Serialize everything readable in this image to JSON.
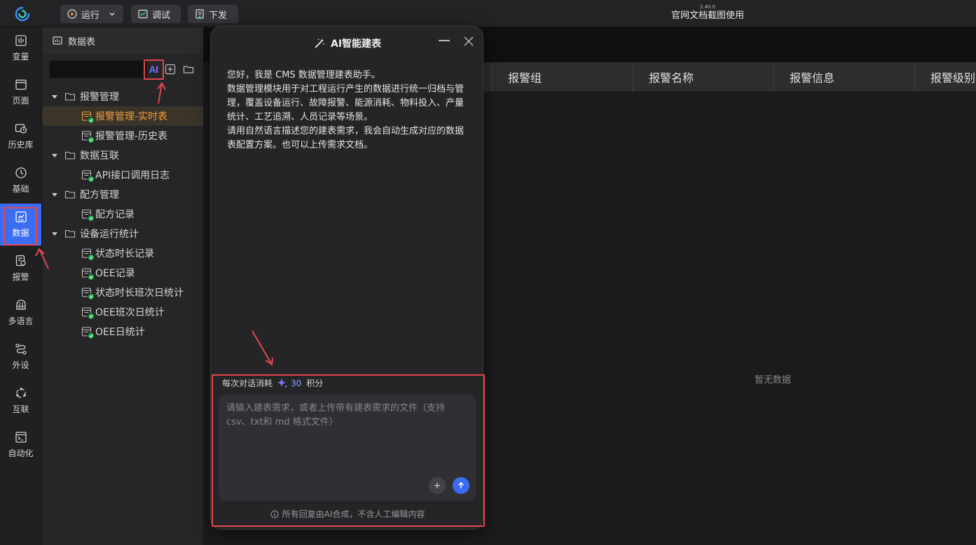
{
  "topbar": {
    "run_label": "运行",
    "debug_label": "调试",
    "deploy_label": "下发",
    "version": "2.40.0",
    "app_title": "官网文档截图使用"
  },
  "leftnav": {
    "items": [
      {
        "label": "变量",
        "icon": "variable-icon"
      },
      {
        "label": "页面",
        "icon": "page-icon"
      },
      {
        "label": "历史库",
        "icon": "history-icon"
      },
      {
        "label": "基础",
        "icon": "base-icon"
      },
      {
        "label": "数据",
        "icon": "data-icon"
      },
      {
        "label": "报警",
        "icon": "alarm-icon"
      },
      {
        "label": "多语言",
        "icon": "language-icon"
      },
      {
        "label": "外设",
        "icon": "peripheral-icon"
      },
      {
        "label": "互联",
        "icon": "interconnect-icon"
      },
      {
        "label": "自动化",
        "icon": "automation-icon"
      }
    ],
    "active_index": 4
  },
  "tree": {
    "header": "数据表",
    "ai_badge": "AI",
    "rows": [
      {
        "label": "报警管理",
        "type": "folder"
      },
      {
        "label": "报警管理-实时表",
        "type": "table",
        "selected": true
      },
      {
        "label": "报警管理-历史表",
        "type": "table"
      },
      {
        "label": "数据互联",
        "type": "folder"
      },
      {
        "label": "API接口调用日志",
        "type": "table"
      },
      {
        "label": "配方管理",
        "type": "folder"
      },
      {
        "label": "配方记录",
        "type": "table"
      },
      {
        "label": "设备运行统计",
        "type": "folder"
      },
      {
        "label": "状态时长记录",
        "type": "table"
      },
      {
        "label": "OEE记录",
        "type": "table"
      },
      {
        "label": "状态时长班次日统计",
        "type": "table"
      },
      {
        "label": "OEE班次日统计",
        "type": "table"
      },
      {
        "label": "OEE日统计",
        "type": "table"
      }
    ]
  },
  "table": {
    "columns": [
      "报警组",
      "报警名称",
      "报警信息",
      "报警级别"
    ],
    "empty_text": "暂无数据"
  },
  "ai_dialog": {
    "title": "AI智能建表",
    "welcome": [
      "您好，我是 CMS 数据管理建表助手。",
      "数据管理模块用于对工程运行产生的数据进行统一归档与管理，覆盖设备运行、故障报警、能源消耗、物料投入、产量统计、工艺追溯、人员记录等场景。",
      "请用自然语言描述您的建表需求，我会自动生成对应的数据表配置方案。也可以上传需求文档。"
    ],
    "cost_prefix": "每次对话消耗",
    "cost_value": "30",
    "cost_suffix": "积分",
    "input_placeholder": "请输入建表需求，或者上传带有建表需求的文件（支持 csv、txt和 md 格式文件）",
    "disclaimer": "所有回复由AI合成，不含人工编辑内容"
  },
  "colors": {
    "accent": "#3b6df2",
    "selected_text": "#ef9d3c",
    "highlight_box": "#e2474f",
    "check_green": "#22b14c"
  }
}
